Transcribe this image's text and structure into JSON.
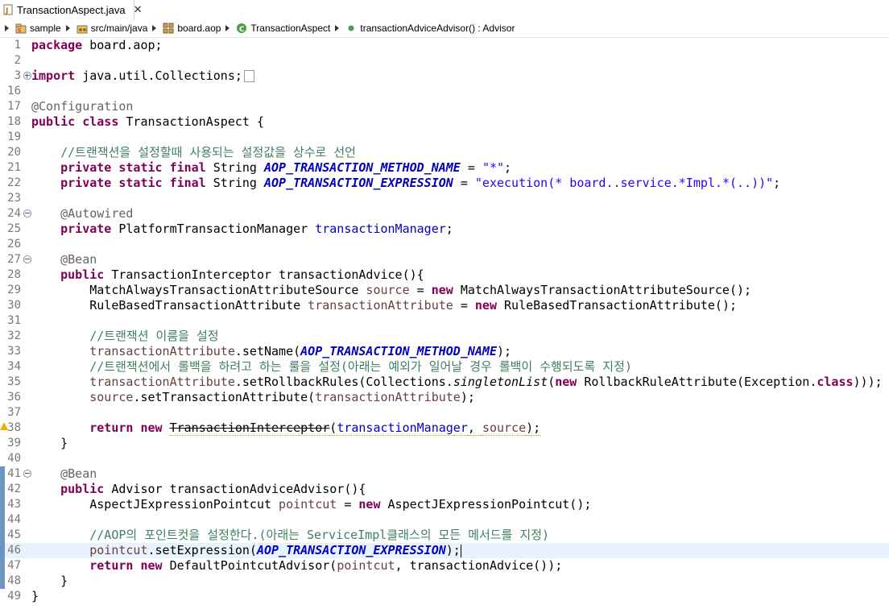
{
  "tab": {
    "title": "TransactionAspect.java",
    "close": "✕"
  },
  "breadcrumb": [
    {
      "label": "sample",
      "icon": "project-icon"
    },
    {
      "label": "src/main/java",
      "icon": "source-folder-icon"
    },
    {
      "label": "board.aop",
      "icon": "package-icon"
    },
    {
      "label": "TransactionAspect",
      "icon": "class-icon"
    },
    {
      "label": "transactionAdviceAdvisor() : Advisor",
      "icon": "method-icon"
    }
  ],
  "colors": {
    "keyword": "#7f0055",
    "comment": "#3f7f5f",
    "string": "#2a00ff",
    "field": "#0000c0",
    "annotation": "#646464",
    "local": "#6a3e3e",
    "current_line": "#e8f2fe"
  },
  "lines": [
    {
      "n": "1",
      "fold": "",
      "mark": "",
      "segs": [
        [
          "kw",
          "package"
        ],
        [
          "",
          "board.aop;"
        ]
      ]
    },
    {
      "n": "2",
      "fold": "",
      "mark": "",
      "segs": []
    },
    {
      "n": "3",
      "fold": "plus",
      "mark": "",
      "segs": [
        [
          "kw",
          "import"
        ],
        [
          "",
          "java.util.Collections;"
        ]
      ],
      "box": true
    },
    {
      "n": "16",
      "fold": "",
      "mark": "",
      "segs": []
    },
    {
      "n": "17",
      "fold": "",
      "mark": "",
      "segs": [
        [
          "ann",
          "@Configuration"
        ]
      ]
    },
    {
      "n": "18",
      "fold": "",
      "mark": "",
      "segs": [
        [
          "kw",
          "public"
        ],
        [
          "",
          " "
        ],
        [
          "kw",
          "class"
        ],
        [
          "",
          "TransactionAspect {"
        ]
      ]
    },
    {
      "n": "19",
      "fold": "",
      "mark": "",
      "segs": []
    },
    {
      "n": "20",
      "fold": "",
      "mark": "",
      "segs": [
        [
          "",
          "    "
        ],
        [
          "cmt",
          "//트랜잭션을 설정할때 사용되는 설정값을 상수로 선언"
        ]
      ]
    },
    {
      "n": "21",
      "fold": "",
      "mark": "",
      "segs": [
        [
          "",
          "    "
        ],
        [
          "kw",
          "private"
        ],
        [
          "",
          " "
        ],
        [
          "kw",
          "static"
        ],
        [
          "",
          " "
        ],
        [
          "kw",
          "final"
        ],
        [
          "",
          "String "
        ],
        [
          "sfld",
          "AOP_TRANSACTION_METHOD_NAME"
        ],
        [
          "",
          " = "
        ],
        [
          "str",
          "\"*\""
        ],
        [
          "",
          ";"
        ]
      ]
    },
    {
      "n": "22",
      "fold": "",
      "mark": "",
      "segs": [
        [
          "",
          "    "
        ],
        [
          "kw",
          "private"
        ],
        [
          "",
          " "
        ],
        [
          "kw",
          "static"
        ],
        [
          "",
          " "
        ],
        [
          "kw",
          "final"
        ],
        [
          "",
          "String "
        ],
        [
          "sfld",
          "AOP_TRANSACTION_EXPRESSION"
        ],
        [
          "",
          " = "
        ],
        [
          "str",
          "\"execution(* board..service.*Impl.*(..))\""
        ],
        [
          "",
          ";"
        ]
      ]
    },
    {
      "n": "23",
      "fold": "",
      "mark": "",
      "segs": []
    },
    {
      "n": "24",
      "fold": "minus",
      "mark": "",
      "segs": [
        [
          "",
          "    "
        ],
        [
          "ann",
          "@Autowired"
        ]
      ]
    },
    {
      "n": "25",
      "fold": "",
      "mark": "",
      "segs": [
        [
          "",
          "    "
        ],
        [
          "kw",
          "private"
        ],
        [
          "",
          "PlatformTransactionManager "
        ],
        [
          "fld",
          "transactionManager"
        ],
        [
          "",
          ";"
        ]
      ]
    },
    {
      "n": "26",
      "fold": "",
      "mark": "",
      "segs": []
    },
    {
      "n": "27",
      "fold": "minus",
      "mark": "",
      "segs": [
        [
          "",
          "    "
        ],
        [
          "ann",
          "@Bean"
        ]
      ]
    },
    {
      "n": "28",
      "fold": "",
      "mark": "",
      "segs": [
        [
          "",
          "    "
        ],
        [
          "kw",
          "public"
        ],
        [
          "",
          "TransactionInterceptor transactionAdvice(){"
        ]
      ]
    },
    {
      "n": "29",
      "fold": "",
      "mark": "",
      "segs": [
        [
          "",
          "        MatchAlwaysTransactionAttributeSource "
        ],
        [
          "var",
          "source"
        ],
        [
          "",
          " = "
        ],
        [
          "kw",
          "new"
        ],
        [
          "",
          " MatchAlwaysTransactionAttributeSource();"
        ]
      ]
    },
    {
      "n": "30",
      "fold": "",
      "mark": "",
      "segs": [
        [
          "",
          "        RuleBasedTransactionAttribute "
        ],
        [
          "var",
          "transactionAttribute"
        ],
        [
          "",
          " = "
        ],
        [
          "kw",
          "new"
        ],
        [
          "",
          " RuleBasedTransactionAttribute();"
        ]
      ]
    },
    {
      "n": "31",
      "fold": "",
      "mark": "",
      "segs": []
    },
    {
      "n": "32",
      "fold": "",
      "mark": "",
      "segs": [
        [
          "",
          "        "
        ],
        [
          "cmt",
          "//트랜잭션 이름을 설정"
        ]
      ]
    },
    {
      "n": "33",
      "fold": "",
      "mark": "",
      "segs": [
        [
          "",
          "        "
        ],
        [
          "var",
          "transactionAttribute"
        ],
        [
          "",
          ".setName("
        ],
        [
          "sfld",
          "AOP_TRANSACTION_METHOD_NAME"
        ],
        [
          "",
          ");"
        ]
      ]
    },
    {
      "n": "34",
      "fold": "",
      "mark": "",
      "segs": [
        [
          "",
          "        "
        ],
        [
          "cmt",
          "//트랜잭션에서 롤백을 하려고 하는 룰을 설정(아래는 예외가 일어날 경우 롤백이 수행되도록 지정)"
        ]
      ]
    },
    {
      "n": "35",
      "fold": "",
      "mark": "",
      "segs": [
        [
          "",
          "        "
        ],
        [
          "var",
          "transactionAttribute"
        ],
        [
          "",
          ".setRollbackRules(Collections."
        ],
        [
          "ital",
          "singletonList"
        ],
        [
          "",
          "("
        ],
        [
          "kw",
          "new"
        ],
        [
          "",
          " RollbackRuleAttribute(Exception."
        ],
        [
          "kw",
          "class"
        ],
        [
          "",
          ")));"
        ]
      ]
    },
    {
      "n": "36",
      "fold": "",
      "mark": "",
      "segs": [
        [
          "",
          "        "
        ],
        [
          "var",
          "source"
        ],
        [
          "",
          ".setTransactionAttribute("
        ],
        [
          "var",
          "transactionAttribute"
        ],
        [
          "",
          ");"
        ]
      ]
    },
    {
      "n": "37",
      "fold": "",
      "mark": "",
      "segs": []
    },
    {
      "n": "38",
      "fold": "",
      "mark": "warn",
      "segs": [
        [
          "",
          "        "
        ],
        [
          "kw",
          "return"
        ],
        [
          "",
          " "
        ],
        [
          "kw",
          "new"
        ],
        [
          "",
          " "
        ],
        [
          "strike",
          "TransactionInterceptor"
        ],
        [
          "",
          "("
        ],
        [
          "fld",
          "transactionManager"
        ],
        [
          "",
          ", "
        ],
        [
          "var",
          "source"
        ],
        [
          "",
          ");"
        ]
      ]
    },
    {
      "n": "39",
      "fold": "",
      "mark": "",
      "segs": [
        [
          "",
          "    }"
        ]
      ]
    },
    {
      "n": "40",
      "fold": "",
      "mark": "",
      "segs": []
    },
    {
      "n": "41",
      "fold": "minus",
      "mark": "change",
      "segs": [
        [
          "",
          "    "
        ],
        [
          "ann",
          "@Bean"
        ]
      ]
    },
    {
      "n": "42",
      "fold": "",
      "mark": "change",
      "segs": [
        [
          "",
          "    "
        ],
        [
          "kw",
          "public"
        ],
        [
          "",
          " Advisor transactionAdviceAdvisor(){"
        ]
      ]
    },
    {
      "n": "43",
      "fold": "",
      "mark": "change",
      "segs": [
        [
          "",
          "        AspectJExpressionPointcut "
        ],
        [
          "var",
          "pointcut"
        ],
        [
          "",
          " = "
        ],
        [
          "kw",
          "new"
        ],
        [
          "",
          " AspectJExpressionPointcut();"
        ]
      ]
    },
    {
      "n": "44",
      "fold": "",
      "mark": "change",
      "segs": []
    },
    {
      "n": "45",
      "fold": "",
      "mark": "change",
      "segs": [
        [
          "",
          "        "
        ],
        [
          "cmt",
          "//AOP의 포인트컷을 설정한다.(아래는 ServiceImpl클래스의 모든 메서드를 지정)"
        ]
      ]
    },
    {
      "n": "46",
      "fold": "",
      "mark": "change",
      "current": true,
      "segs": [
        [
          "",
          "        "
        ],
        [
          "var",
          "pointcut"
        ],
        [
          "",
          ".setExpression("
        ],
        [
          "sfld",
          "AOP_TRANSACTION_EXPRESSION"
        ],
        [
          "",
          ");"
        ]
      ],
      "caret": true
    },
    {
      "n": "47",
      "fold": "",
      "mark": "change",
      "segs": [
        [
          "",
          "        "
        ],
        [
          "kw",
          "return"
        ],
        [
          "",
          " "
        ],
        [
          "kw",
          "new"
        ],
        [
          "",
          " DefaultPointcutAdvisor("
        ],
        [
          "var",
          "pointcut"
        ],
        [
          "",
          ", transactionAdvice());"
        ]
      ]
    },
    {
      "n": "48",
      "fold": "",
      "mark": "change",
      "segs": [
        [
          "",
          "    }"
        ]
      ]
    },
    {
      "n": "49",
      "fold": "",
      "mark": "",
      "segs": [
        [
          "",
          "}"
        ]
      ]
    }
  ]
}
